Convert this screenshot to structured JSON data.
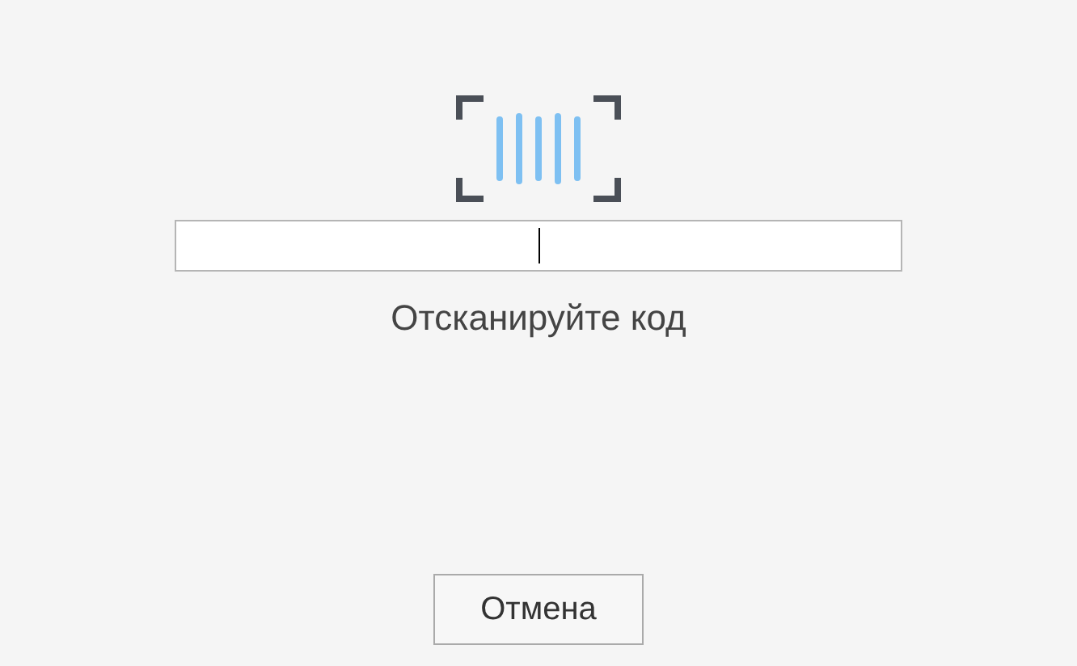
{
  "scan_field": {
    "focused": true
  },
  "prompt": "Отсканируйте код",
  "cancel_button": "Отмена"
}
